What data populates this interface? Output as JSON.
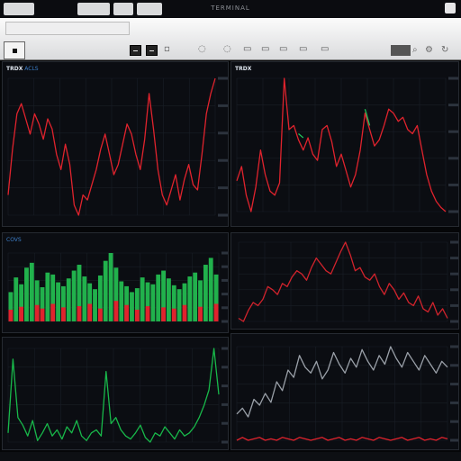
{
  "window": {
    "title": "TERMINAL"
  },
  "toolbar": {
    "icons": [
      "back-icon",
      "minimize-icon",
      "maximize-icon",
      "close-icon",
      "settings-icon",
      "refresh-icon",
      "search-icon"
    ]
  },
  "panels": [
    {
      "id": "top-left",
      "header": {
        "symbol": "TRDX",
        "text": "ACLS"
      },
      "footer": "",
      "ticks": [
        "",
        "",
        "",
        "",
        ""
      ],
      "chart_type": "line",
      "color": "#e0232d"
    },
    {
      "id": "top-right",
      "header": {
        "symbol": "TRDX",
        "text": ""
      },
      "footer": "",
      "ticks": [
        "",
        "",
        "",
        "",
        ""
      ],
      "chart_type": "line",
      "color": "#e0232d"
    },
    {
      "id": "mid-left",
      "header": {
        "symbol": "COVS",
        "text": ""
      },
      "footer": "",
      "ticks": [
        "",
        "",
        "",
        ""
      ],
      "chart_type": "bar",
      "color": "#21b14c"
    },
    {
      "id": "mid-right",
      "header": {
        "symbol": "",
        "text": ""
      },
      "footer": "",
      "ticks": [
        "",
        "",
        "",
        ""
      ],
      "chart_type": "line",
      "color": "#d1232c"
    },
    {
      "id": "bottom-left",
      "header": {
        "symbol": "",
        "text": ""
      },
      "footer": "",
      "ticks": [
        "",
        "",
        "",
        ""
      ],
      "chart_type": "line",
      "color": "#18b84a"
    },
    {
      "id": "bottom-right",
      "header": {
        "symbol": "",
        "text": ""
      },
      "footer": "",
      "ticks": [
        "",
        "",
        "",
        ""
      ],
      "chart_type": "line",
      "color": "#9aa0a8"
    }
  ],
  "chart_data": [
    {
      "type": "line",
      "title": "",
      "series": [
        {
          "color": "#e0232d",
          "values": [
            32,
            41,
            48,
            50,
            47,
            44,
            48,
            46,
            43,
            47,
            45,
            40,
            37,
            42,
            38,
            30,
            28,
            32,
            31,
            34,
            37,
            41,
            44,
            40,
            36,
            38,
            42,
            46,
            44,
            40,
            37,
            43,
            52,
            45,
            37,
            32,
            30,
            33,
            36,
            31,
            35,
            38,
            34,
            33,
            40,
            48,
            52,
            55
          ]
        }
      ]
    },
    {
      "type": "line",
      "title": "",
      "series": [
        {
          "color": "#e0232d",
          "values": [
            45,
            52,
            38,
            30,
            42,
            60,
            48,
            40,
            38,
            44,
            95,
            70,
            72,
            65,
            60,
            66,
            58,
            55,
            70,
            72,
            64,
            52,
            58,
            50,
            42,
            48,
            60,
            78,
            70,
            62,
            65,
            72,
            80,
            78,
            74,
            76,
            70,
            68,
            72,
            60,
            48,
            40,
            35,
            32,
            30
          ]
        },
        {
          "color": "#20c05a",
          "values": [
            null,
            null,
            null,
            null,
            null,
            null,
            null,
            null,
            null,
            null,
            null,
            null,
            null,
            68,
            66,
            null,
            null,
            null,
            null,
            null,
            null,
            null,
            null,
            null,
            null,
            null,
            null,
            80,
            72,
            null,
            null,
            null,
            null,
            null,
            null,
            null,
            null,
            null,
            null,
            null,
            null,
            null,
            null,
            null,
            null
          ]
        }
      ]
    },
    {
      "type": "bar",
      "title": "",
      "series": [
        {
          "color": "#21b14c",
          "values": [
            30,
            45,
            38,
            55,
            60,
            42,
            35,
            50,
            48,
            40,
            36,
            44,
            52,
            58,
            46,
            39,
            33,
            47,
            62,
            70,
            55,
            41,
            36,
            30,
            34,
            45,
            40,
            38,
            48,
            52,
            44,
            37,
            33,
            39,
            46,
            50,
            42,
            58,
            65,
            48
          ]
        },
        {
          "color": "#e0232d",
          "values": [
            20,
            0,
            25,
            0,
            0,
            28,
            22,
            0,
            30,
            0,
            24,
            0,
            0,
            26,
            0,
            30,
            0,
            22,
            0,
            0,
            35,
            0,
            28,
            0,
            20,
            0,
            26,
            0,
            0,
            24,
            0,
            22,
            0,
            28,
            0,
            0,
            25,
            0,
            0,
            30
          ]
        }
      ]
    },
    {
      "type": "line",
      "title": "",
      "series": [
        {
          "color": "#d1232c",
          "values": [
            40,
            38,
            45,
            50,
            48,
            52,
            60,
            58,
            55,
            62,
            60,
            66,
            70,
            68,
            64,
            72,
            78,
            74,
            70,
            68,
            75,
            82,
            88,
            80,
            70,
            72,
            66,
            64,
            68,
            60,
            55,
            62,
            58,
            52,
            56,
            50,
            48,
            54,
            46,
            44,
            50,
            42,
            46,
            40
          ]
        }
      ]
    },
    {
      "type": "line",
      "title": "",
      "series": [
        {
          "color": "#18b84a",
          "values": [
            30,
            78,
            40,
            35,
            28,
            38,
            25,
            30,
            36,
            28,
            32,
            26,
            34,
            30,
            38,
            28,
            25,
            30,
            32,
            28,
            70,
            36,
            40,
            32,
            28,
            26,
            30,
            35,
            27,
            24,
            30,
            28,
            34,
            30,
            26,
            32,
            28,
            30,
            34,
            40,
            48,
            58,
            85,
            55
          ]
        }
      ]
    },
    {
      "type": "line",
      "title": "",
      "series": [
        {
          "color": "#9aa0a8",
          "values": [
            30,
            34,
            28,
            40,
            36,
            44,
            38,
            52,
            46,
            60,
            55,
            70,
            62,
            58,
            66,
            54,
            60,
            72,
            64,
            58,
            68,
            62,
            74,
            66,
            60,
            70,
            64,
            76,
            68,
            62,
            72,
            66,
            60,
            70,
            64,
            58,
            66,
            62
          ]
        },
        {
          "color": "#e0232d",
          "values": [
            12,
            14,
            12,
            13,
            14,
            12,
            13,
            12,
            14,
            13,
            12,
            14,
            13,
            12,
            13,
            14,
            12,
            13,
            14,
            12,
            13,
            12,
            14,
            13,
            12,
            14,
            13,
            12,
            13,
            14,
            12,
            13,
            14,
            12,
            13,
            12,
            14,
            13
          ]
        }
      ]
    }
  ]
}
